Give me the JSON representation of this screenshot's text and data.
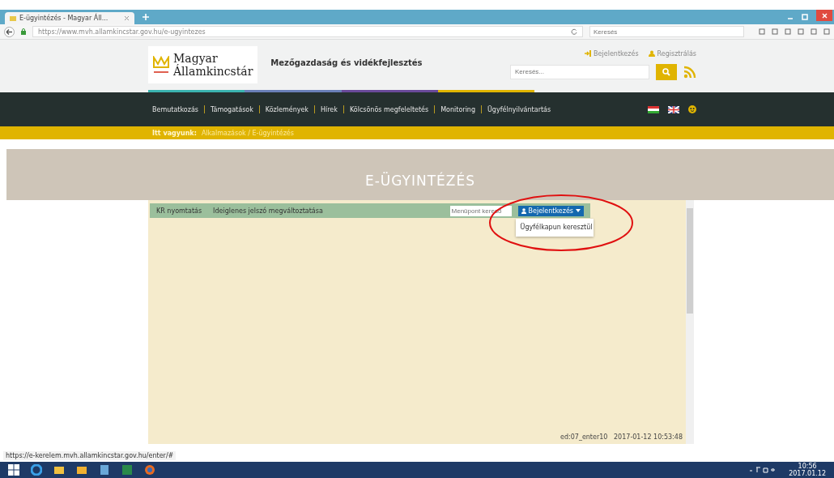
{
  "browser": {
    "tab": {
      "title": "E-ügyintézés - Magyar Áll...",
      "selected": true
    },
    "url": "https://www.mvh.allamkincstar.gov.hu/e-ugyintezes",
    "search_placeholder": "Keresés"
  },
  "header": {
    "logo_line1": "Magyar",
    "logo_line2": "Államkincstár",
    "subtitle": "Mezőgazdaság és vidékfejlesztés",
    "links": [
      "Bejelentkezés",
      "Regisztrálás"
    ],
    "search_placeholder": "Keresés..."
  },
  "nav": {
    "items": [
      "Bemutatkozás",
      "Támogatások",
      "Közlemények",
      "Hírek",
      "Kölcsönös megfeleltetés",
      "Monitoring",
      "Ügyfélnyilvántartás"
    ]
  },
  "breadcrumb": {
    "label": "Itt vagyunk:",
    "path": "Alkalmazások / E-ügyintézés"
  },
  "page_title": "E-ÜGYINTÉZÉS",
  "app": {
    "menu": [
      "KR nyomtatás",
      "Ideiglenes jelszó megváltoztatása"
    ],
    "field_placeholder": "Menüpont kereső",
    "login_button": "Bejelentkezés",
    "dropdown": {
      "expanded": true,
      "items": [
        "Ügyfélkapun keresztül"
      ]
    },
    "footer": "ed:07_enter10   2017-01-12 10:53:48"
  },
  "status_url": "https://e-kerelem.mvh.allamkincstar.gov.hu/enter/#",
  "taskbar": {
    "time": "10:56",
    "date": "2017.01.12"
  }
}
